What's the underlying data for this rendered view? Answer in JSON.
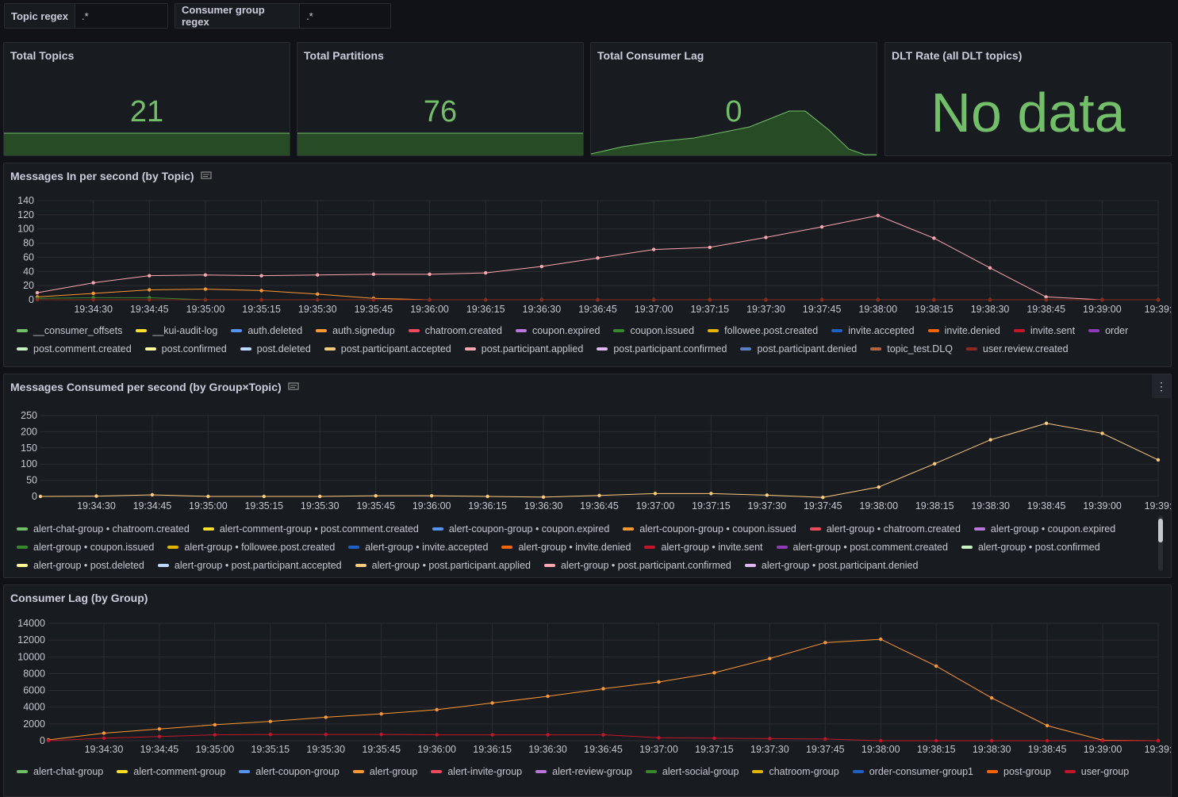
{
  "variables": {
    "topic": {
      "label": "Topic regex",
      "value": ".*"
    },
    "group": {
      "label": "Consumer group regex",
      "value": ".*"
    }
  },
  "stats": {
    "topics": {
      "title": "Total Topics",
      "value": "21"
    },
    "partitions": {
      "title": "Total Partitions",
      "value": "76"
    },
    "lag": {
      "title": "Total Consumer Lag",
      "value": "0"
    },
    "dlt": {
      "title": "DLT Rate (all DLT topics)",
      "value": "No data"
    }
  },
  "colors": {
    "green": "#73bf69",
    "panel_bg": "#181b1f",
    "border": "#2b2c33",
    "text": "#ccccdc"
  },
  "panels": {
    "messages_in": {
      "title": "Messages In per second (by Topic)"
    },
    "consumed": {
      "title": "Messages Consumed per second (by Group×Topic)"
    },
    "lag_group": {
      "title": "Consumer Lag (by Group)"
    }
  },
  "legends": {
    "messages_in": [
      {
        "name": "__consumer_offsets",
        "color": "#73bf69"
      },
      {
        "name": "__kui-audit-log",
        "color": "#fade2a"
      },
      {
        "name": "auth.deleted",
        "color": "#5794f2"
      },
      {
        "name": "auth.signedup",
        "color": "#ff9830"
      },
      {
        "name": "chatroom.created",
        "color": "#f2495c"
      },
      {
        "name": "coupon.expired",
        "color": "#b877d9"
      },
      {
        "name": "coupon.issued",
        "color": "#37872d"
      },
      {
        "name": "followee.post.created",
        "color": "#e0b400"
      },
      {
        "name": "invite.accepted",
        "color": "#1f60c4"
      },
      {
        "name": "invite.denied",
        "color": "#fa6400"
      },
      {
        "name": "invite.sent",
        "color": "#c4162a"
      },
      {
        "name": "order",
        "color": "#8f3bb8"
      },
      {
        "name": "post.comment.created",
        "color": "#c8f2c2"
      },
      {
        "name": "post.confirmed",
        "color": "#fff899"
      },
      {
        "name": "post.deleted",
        "color": "#c0d8ff"
      },
      {
        "name": "post.participant.accepted",
        "color": "#ffcb7d"
      },
      {
        "name": "post.participant.applied",
        "color": "#ffa6b0"
      },
      {
        "name": "post.participant.confirmed",
        "color": "#deb6f2"
      },
      {
        "name": "post.participant.denied",
        "color": "#5a7ec2"
      },
      {
        "name": "topic_test.DLQ",
        "color": "#b4633f"
      },
      {
        "name": "user.review.created",
        "color": "#8a2a1f"
      }
    ],
    "consumed": [
      {
        "name": "alert-chat-group • chatroom.created",
        "color": "#73bf69"
      },
      {
        "name": "alert-comment-group • post.comment.created",
        "color": "#fade2a"
      },
      {
        "name": "alert-coupon-group • coupon.expired",
        "color": "#5794f2"
      },
      {
        "name": "alert-coupon-group • coupon.issued",
        "color": "#ff9830"
      },
      {
        "name": "alert-group • chatroom.created",
        "color": "#f2495c"
      },
      {
        "name": "alert-group • coupon.expired",
        "color": "#b877d9"
      },
      {
        "name": "alert-group • coupon.issued",
        "color": "#37872d"
      },
      {
        "name": "alert-group • followee.post.created",
        "color": "#e0b400"
      },
      {
        "name": "alert-group • invite.accepted",
        "color": "#1f60c4"
      },
      {
        "name": "alert-group • invite.denied",
        "color": "#fa6400"
      },
      {
        "name": "alert-group • invite.sent",
        "color": "#c4162a"
      },
      {
        "name": "alert-group • post.comment.created",
        "color": "#8f3bb8"
      },
      {
        "name": "alert-group • post.confirmed",
        "color": "#c8f2c2"
      },
      {
        "name": "alert-group • post.deleted",
        "color": "#fff899"
      },
      {
        "name": "alert-group • post.participant.accepted",
        "color": "#c0d8ff"
      },
      {
        "name": "alert-group • post.participant.applied",
        "color": "#ffcb7d"
      },
      {
        "name": "alert-group • post.participant.confirmed",
        "color": "#ffa6b0"
      },
      {
        "name": "alert-group • post.participant.denied",
        "color": "#deb6f2"
      }
    ],
    "lag_group": [
      {
        "name": "alert-chat-group",
        "color": "#73bf69"
      },
      {
        "name": "alert-comment-group",
        "color": "#fade2a"
      },
      {
        "name": "alert-coupon-group",
        "color": "#5794f2"
      },
      {
        "name": "alert-group",
        "color": "#ff9830"
      },
      {
        "name": "alert-invite-group",
        "color": "#f2495c"
      },
      {
        "name": "alert-review-group",
        "color": "#b877d9"
      },
      {
        "name": "alert-social-group",
        "color": "#37872d"
      },
      {
        "name": "chatroom-group",
        "color": "#e0b400"
      },
      {
        "name": "order-consumer-group1",
        "color": "#1f60c4"
      },
      {
        "name": "post-group",
        "color": "#fa6400"
      },
      {
        "name": "user-group",
        "color": "#c4162a"
      }
    ]
  },
  "chart_data": [
    {
      "type": "line",
      "title": "Messages In per second (by Topic)",
      "x": [
        "19:34:15",
        "19:34:30",
        "19:34:45",
        "19:35:00",
        "19:35:15",
        "19:35:30",
        "19:35:45",
        "19:36:00",
        "19:36:15",
        "19:36:30",
        "19:36:45",
        "19:37:00",
        "19:37:15",
        "19:37:30",
        "19:37:45",
        "19:38:00",
        "19:38:15",
        "19:38:30",
        "19:38:45",
        "19:39:00",
        "19:39:15"
      ],
      "x_ticks": [
        "19:34:30",
        "19:34:45",
        "19:35:00",
        "19:35:15",
        "19:35:30",
        "19:35:45",
        "19:36:00",
        "19:36:15",
        "19:36:30",
        "19:36:45",
        "19:37:00",
        "19:37:15",
        "19:37:30",
        "19:37:45",
        "19:38:00",
        "19:38:15",
        "19:38:30",
        "19:38:45",
        "19:39:00",
        "19:39:"
      ],
      "y_ticks": [
        "140",
        "120",
        "100",
        "80",
        "60",
        "40",
        "20",
        "0"
      ],
      "ylim": [
        0,
        140
      ],
      "series": [
        {
          "name": "post.participant.applied",
          "color": "#ffa6b0",
          "values": [
            10,
            24,
            34,
            35,
            34,
            35,
            36,
            36,
            38,
            47,
            59,
            71,
            74,
            88,
            103,
            119,
            87,
            45,
            4,
            0,
            0
          ]
        },
        {
          "name": "auth.signedup",
          "color": "#ff9830",
          "values": [
            4,
            9,
            14,
            15,
            13,
            8,
            2,
            0,
            0,
            0,
            0,
            0,
            0,
            0,
            0,
            0,
            0,
            0,
            0,
            0,
            0
          ]
        },
        {
          "name": "coupon.issued",
          "color": "#37872d",
          "values": [
            2,
            3,
            3,
            0,
            0,
            0,
            0,
            0,
            0,
            0,
            0,
            0,
            0,
            0,
            0,
            0,
            0,
            0,
            0,
            0,
            0
          ]
        },
        {
          "name": "user.review.created",
          "color": "#8a2a1f",
          "values": [
            0,
            0,
            0,
            0,
            0,
            0,
            0,
            0,
            0,
            0,
            0,
            0,
            0,
            0,
            0,
            0,
            0,
            0,
            0,
            0,
            0
          ]
        }
      ]
    },
    {
      "type": "line",
      "title": "Messages Consumed per second (by Group×Topic)",
      "x": [
        "19:34:15",
        "19:34:30",
        "19:34:45",
        "19:35:00",
        "19:35:15",
        "19:35:30",
        "19:35:45",
        "19:36:00",
        "19:36:15",
        "19:36:30",
        "19:36:45",
        "19:37:00",
        "19:37:15",
        "19:37:30",
        "19:37:45",
        "19:38:00",
        "19:38:15",
        "19:38:30",
        "19:38:45",
        "19:39:00",
        "19:39:15"
      ],
      "x_ticks": [
        "19:34:30",
        "19:34:45",
        "19:35:00",
        "19:35:15",
        "19:35:30",
        "19:35:45",
        "19:36:00",
        "19:36:15",
        "19:36:30",
        "19:36:45",
        "19:37:00",
        "19:37:15",
        "19:37:30",
        "19:37:45",
        "19:38:00",
        "19:38:15",
        "19:38:30",
        "19:38:45",
        "19:39:00",
        "19:39:"
      ],
      "y_ticks": [
        "250",
        "200",
        "150",
        "100",
        "50",
        "0"
      ],
      "ylim": [
        0,
        250
      ],
      "series": [
        {
          "name": "alert-group • post.participant.applied",
          "color": "#ffcb7d",
          "values": [
            0,
            1,
            5,
            0,
            0,
            0,
            2,
            2,
            0,
            -2,
            3,
            9,
            9,
            4,
            -3,
            29,
            101,
            175,
            226,
            195,
            113
          ]
        }
      ]
    },
    {
      "type": "line",
      "title": "Consumer Lag (by Group)",
      "x": [
        "19:34:15",
        "19:34:30",
        "19:34:45",
        "19:35:00",
        "19:35:15",
        "19:35:30",
        "19:35:45",
        "19:36:00",
        "19:36:15",
        "19:36:30",
        "19:36:45",
        "19:37:00",
        "19:37:15",
        "19:37:30",
        "19:37:45",
        "19:38:00",
        "19:38:15",
        "19:38:30",
        "19:38:45",
        "19:39:00",
        "19:39:15"
      ],
      "x_ticks": [
        "19:34:30",
        "19:34:45",
        "19:35:00",
        "19:35:15",
        "19:35:30",
        "19:35:45",
        "19:36:00",
        "19:36:15",
        "19:36:30",
        "19:36:45",
        "19:37:00",
        "19:37:15",
        "19:37:30",
        "19:37:45",
        "19:38:00",
        "19:38:15",
        "19:38:30",
        "19:38:45",
        "19:39:00",
        "19:39:"
      ],
      "y_ticks": [
        "14000",
        "12000",
        "10000",
        "8000",
        "6000",
        "4000",
        "2000",
        "0"
      ],
      "ylim": [
        0,
        14000
      ],
      "series": [
        {
          "name": "alert-group",
          "color": "#ff9830",
          "values": [
            100,
            900,
            1400,
            1900,
            2300,
            2800,
            3200,
            3700,
            4500,
            5300,
            6200,
            7000,
            8100,
            9800,
            11700,
            12100,
            8900,
            5100,
            1800,
            50,
            0
          ]
        },
        {
          "name": "user-group",
          "color": "#c4162a",
          "values": [
            0,
            300,
            500,
            700,
            750,
            750,
            750,
            700,
            700,
            700,
            700,
            350,
            300,
            250,
            200,
            0,
            0,
            0,
            0,
            0,
            0
          ]
        }
      ]
    }
  ]
}
